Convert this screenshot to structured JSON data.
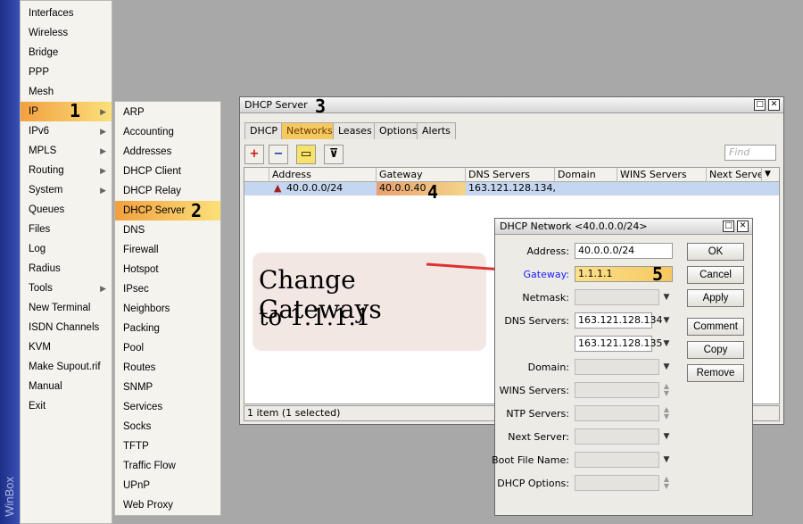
{
  "app": {
    "name": "WinBox"
  },
  "main_menu": [
    {
      "label": "Interfaces",
      "submenu": false
    },
    {
      "label": "Wireless",
      "submenu": false
    },
    {
      "label": "Bridge",
      "submenu": false
    },
    {
      "label": "PPP",
      "submenu": false
    },
    {
      "label": "Mesh",
      "submenu": false
    },
    {
      "label": "IP",
      "submenu": true,
      "selected": true
    },
    {
      "label": "IPv6",
      "submenu": true
    },
    {
      "label": "MPLS",
      "submenu": true
    },
    {
      "label": "Routing",
      "submenu": true
    },
    {
      "label": "System",
      "submenu": true
    },
    {
      "label": "Queues",
      "submenu": false
    },
    {
      "label": "Files",
      "submenu": false
    },
    {
      "label": "Log",
      "submenu": false
    },
    {
      "label": "Radius",
      "submenu": false
    },
    {
      "label": "Tools",
      "submenu": true
    },
    {
      "label": "New Terminal",
      "submenu": false
    },
    {
      "label": "ISDN Channels",
      "submenu": false
    },
    {
      "label": "KVM",
      "submenu": false
    },
    {
      "label": "Make Supout.rif",
      "submenu": false
    },
    {
      "label": "Manual",
      "submenu": false
    },
    {
      "label": "Exit",
      "submenu": false
    }
  ],
  "submenu_arrow": "▶",
  "ip_menu": [
    {
      "label": "ARP"
    },
    {
      "label": "Accounting"
    },
    {
      "label": "Addresses"
    },
    {
      "label": "DHCP Client"
    },
    {
      "label": "DHCP Relay"
    },
    {
      "label": "DHCP Server",
      "selected": true
    },
    {
      "label": "DNS"
    },
    {
      "label": "Firewall"
    },
    {
      "label": "Hotspot"
    },
    {
      "label": "IPsec"
    },
    {
      "label": "Neighbors"
    },
    {
      "label": "Packing"
    },
    {
      "label": "Pool"
    },
    {
      "label": "Routes"
    },
    {
      "label": "SNMP"
    },
    {
      "label": "Services"
    },
    {
      "label": "Socks"
    },
    {
      "label": "TFTP"
    },
    {
      "label": "Traffic Flow"
    },
    {
      "label": "UPnP"
    },
    {
      "label": "Web Proxy"
    }
  ],
  "step_badges": {
    "s1": "1",
    "s2": "2",
    "s3": "3",
    "s4": "4",
    "s5": "5"
  },
  "dhcp_server_window": {
    "title": "DHCP Server",
    "tabs": [
      "DHCP",
      "Networks",
      "Leases",
      "Options",
      "Alerts"
    ],
    "active_tab": "Networks",
    "toolbar": {
      "add": "+",
      "remove": "−",
      "comment": "▭",
      "filter": "⊽"
    },
    "find_placeholder": "Find",
    "columns": [
      "Address",
      "Gateway",
      "DNS Servers",
      "Domain",
      "WINS Servers",
      "Next Server"
    ],
    "rows": [
      {
        "address": "40.0.0.0/24",
        "gateway": "40.0.0.40",
        "dns_servers": "163.121.128.134,...",
        "domain": "",
        "wins_servers": "",
        "next_server": ""
      }
    ],
    "status": "1 item (1 selected)"
  },
  "dhcp_network_window": {
    "title": "DHCP Network <40.0.0.0/24>",
    "fields": {
      "address": {
        "label": "Address:",
        "value": "40.0.0.0/24"
      },
      "gateway": {
        "label": "Gateway:",
        "value": "1.1.1.1"
      },
      "netmask": {
        "label": "Netmask:",
        "value": ""
      },
      "dns_servers": {
        "label": "DNS Servers:",
        "values": [
          "163.121.128.134",
          "163.121.128.135"
        ]
      },
      "domain": {
        "label": "Domain:",
        "value": ""
      },
      "wins_servers": {
        "label": "WINS Servers:",
        "value": ""
      },
      "ntp_servers": {
        "label": "NTP Servers:",
        "value": ""
      },
      "next_server": {
        "label": "Next Server:",
        "value": ""
      },
      "boot_file_name": {
        "label": "Boot File Name:",
        "value": ""
      },
      "dhcp_options": {
        "label": "DHCP Options:",
        "value": ""
      }
    },
    "buttons": {
      "ok": "OK",
      "cancel": "Cancel",
      "apply": "Apply",
      "comment": "Comment",
      "copy": "Copy",
      "remove": "Remove"
    }
  },
  "annotation": {
    "line1": "Change Gateways",
    "line2": "to  1.1.1.1",
    "arrow_color": "#e03030"
  }
}
